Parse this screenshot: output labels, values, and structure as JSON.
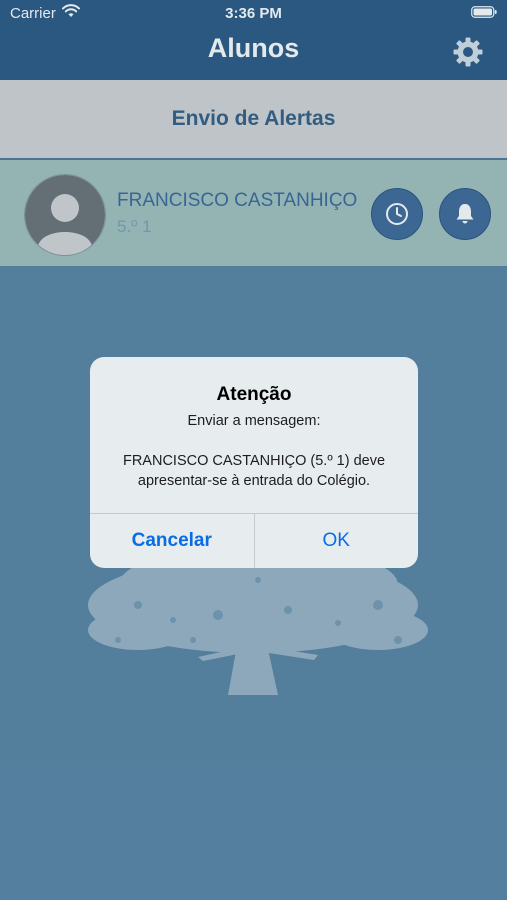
{
  "status_bar": {
    "carrier": "Carrier",
    "time": "3:36 PM"
  },
  "nav": {
    "title": "Alunos",
    "settings_icon": "gear-icon"
  },
  "header": {
    "title": "Envio de Alertas"
  },
  "student": {
    "name": "FRANCISCO CASTANHIÇO",
    "class": "5.º 1",
    "history_icon": "clock-icon",
    "alert_icon": "bell-icon"
  },
  "dialog": {
    "title": "Atenção",
    "message": "Enviar a mensagem:\n\nFRANCISCO CASTANHIÇO (5.º 1) deve apresentar-se à entrada do Colégio.",
    "cancel_label": "Cancelar",
    "ok_label": "OK"
  },
  "colors": {
    "nav_bar": "#2c5a85",
    "background": "#5b87a6",
    "row_background": "#a4c3bf",
    "accent": "#0a6ce4"
  }
}
